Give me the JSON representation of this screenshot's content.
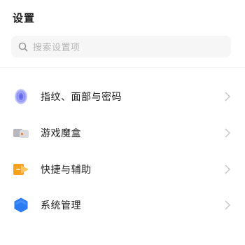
{
  "header": {
    "title": "设置"
  },
  "search": {
    "placeholder": "搜索设置项",
    "icon": "search-icon"
  },
  "menu": {
    "items": [
      {
        "label": "指纹、面部与密码",
        "icon": "fingerprint-icon",
        "color": "#6f72f0"
      },
      {
        "label": "游戏魔盒",
        "icon": "game-box-icon",
        "color": "#b5b5b5"
      },
      {
        "label": "快捷与辅助",
        "icon": "shortcut-icon",
        "color": "#f5a623"
      },
      {
        "label": "系统管理",
        "icon": "system-hexagon-icon",
        "color": "#2d7df6"
      }
    ]
  }
}
